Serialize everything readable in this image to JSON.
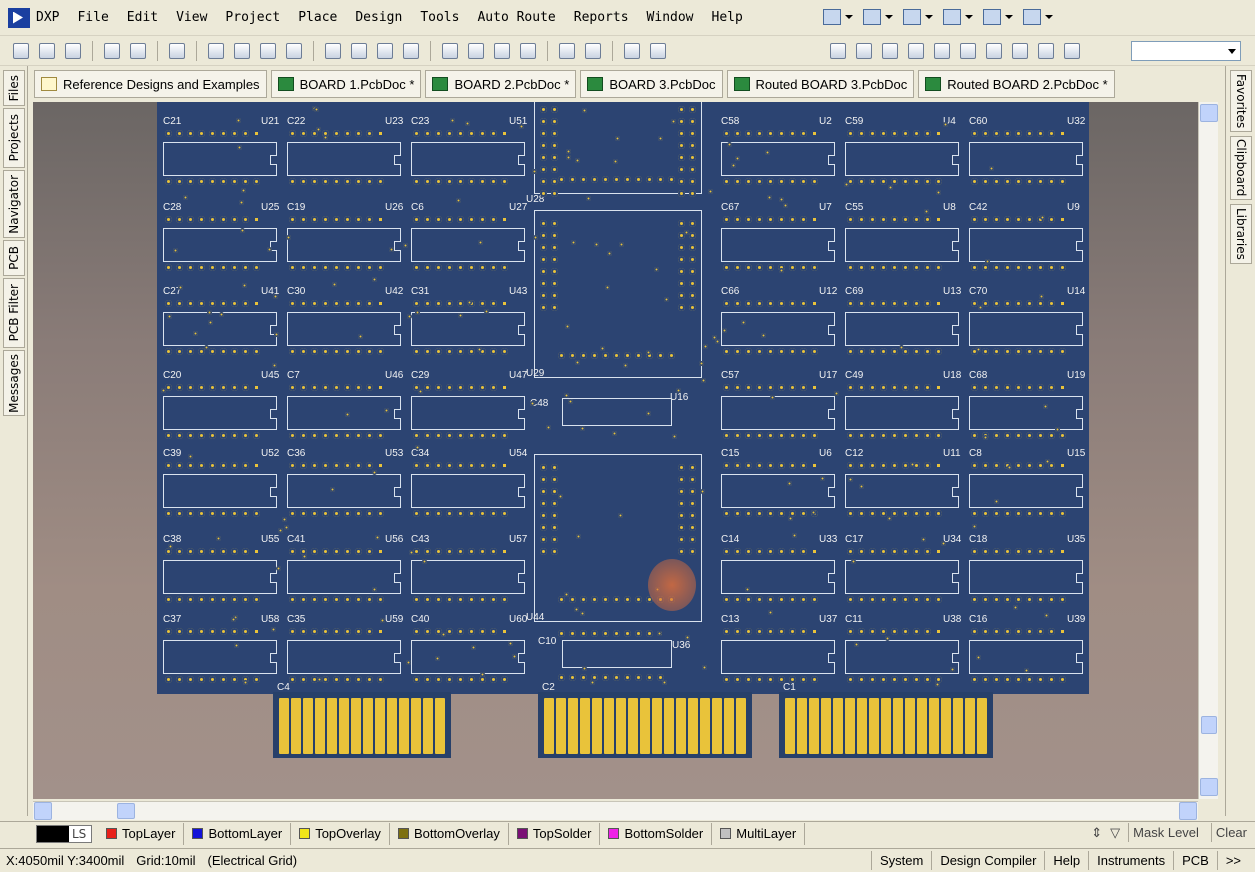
{
  "menu": {
    "app": "DXP",
    "items": [
      "File",
      "Edit",
      "View",
      "Project",
      "Place",
      "Design",
      "Tools",
      "Auto Route",
      "Reports",
      "Window",
      "Help"
    ]
  },
  "left_panels": [
    "Files",
    "Projects",
    "Navigator",
    "PCB",
    "PCB Filter",
    "Messages"
  ],
  "right_panels": [
    "Favorites",
    "Clipboard",
    "Libraries"
  ],
  "doc_tabs": [
    "Reference Designs and Examples",
    "BOARD 1.PcbDoc *",
    "BOARD 2.PcbDoc *",
    "BOARD 3.PcbDoc",
    "Routed BOARD 3.PcbDoc",
    "Routed BOARD 2.PcbDoc *"
  ],
  "pcb": {
    "left_col": [
      {
        "c": "C21",
        "u": "U21"
      },
      {
        "c": "C22",
        "u": "U23"
      },
      {
        "c": "C23",
        "u": "U51"
      },
      {
        "c": "C28",
        "u": "U25"
      },
      {
        "c": "C19",
        "u": "U26"
      },
      {
        "c": "C6",
        "u": "U27"
      },
      {
        "c": "C27",
        "u": "U41"
      },
      {
        "c": "C30",
        "u": "U42"
      },
      {
        "c": "C31",
        "u": "U43"
      },
      {
        "c": "C20",
        "u": "U45"
      },
      {
        "c": "C7",
        "u": "U46"
      },
      {
        "c": "C29",
        "u": "U47"
      },
      {
        "c": "C39",
        "u": "U52"
      },
      {
        "c": "C36",
        "u": "U53"
      },
      {
        "c": "C34",
        "u": "U54"
      },
      {
        "c": "C38",
        "u": "U55"
      },
      {
        "c": "C41",
        "u": "U56"
      },
      {
        "c": "C43",
        "u": "U57"
      },
      {
        "c": "C37",
        "u": "U58"
      },
      {
        "c": "C35",
        "u": "U59"
      },
      {
        "c": "C40",
        "u": "U60"
      }
    ],
    "right_col": [
      {
        "c": "C58",
        "u": "U2"
      },
      {
        "c": "C59",
        "u": "U4"
      },
      {
        "c": "C60",
        "u": "U32"
      },
      {
        "c": "C67",
        "u": "U7"
      },
      {
        "c": "C55",
        "u": "U8"
      },
      {
        "c": "C42",
        "u": "U9"
      },
      {
        "c": "C66",
        "u": "U12"
      },
      {
        "c": "C69",
        "u": "U13"
      },
      {
        "c": "C70",
        "u": "U14"
      },
      {
        "c": "C57",
        "u": "U17"
      },
      {
        "c": "C49",
        "u": "U18"
      },
      {
        "c": "C68",
        "u": "U19"
      },
      {
        "c": "C15",
        "u": "U6"
      },
      {
        "c": "C12",
        "u": "U11"
      },
      {
        "c": "C8",
        "u": "U15"
      },
      {
        "c": "C14",
        "u": "U33"
      },
      {
        "c": "C17",
        "u": "U34"
      },
      {
        "c": "C18",
        "u": "U35"
      },
      {
        "c": "C13",
        "u": "U37"
      },
      {
        "c": "C11",
        "u": "U38"
      },
      {
        "c": "C16",
        "u": "U39"
      }
    ],
    "center": {
      "u28": "U28",
      "u29": "U29",
      "u44": "U44",
      "c48": "C48",
      "u16": "U16",
      "c10": "C10",
      "u36": "U36"
    },
    "fingers": [
      "C4",
      "C2",
      "C1"
    ]
  },
  "layers": [
    {
      "name": "TopLayer",
      "color": "#e8201a"
    },
    {
      "name": "BottomLayer",
      "color": "#1212d8"
    },
    {
      "name": "TopOverlay",
      "color": "#f1e51a"
    },
    {
      "name": "BottomOverlay",
      "color": "#7d7010"
    },
    {
      "name": "TopSolder",
      "color": "#7a1075"
    },
    {
      "name": "BottomSolder",
      "color": "#f020e8"
    },
    {
      "name": "MultiLayer",
      "color": "#c0c0c0"
    }
  ],
  "layer_current": "LS",
  "layer_right": {
    "mask": "Mask Level",
    "clear": "Clear"
  },
  "status": {
    "coords": "X:4050mil Y:3400mil",
    "grid": "Grid:10mil",
    "grid_type": "(Electrical Grid)",
    "buttons": [
      "System",
      "Design Compiler",
      "Help",
      "Instruments",
      "PCB"
    ],
    "more": ">>"
  }
}
